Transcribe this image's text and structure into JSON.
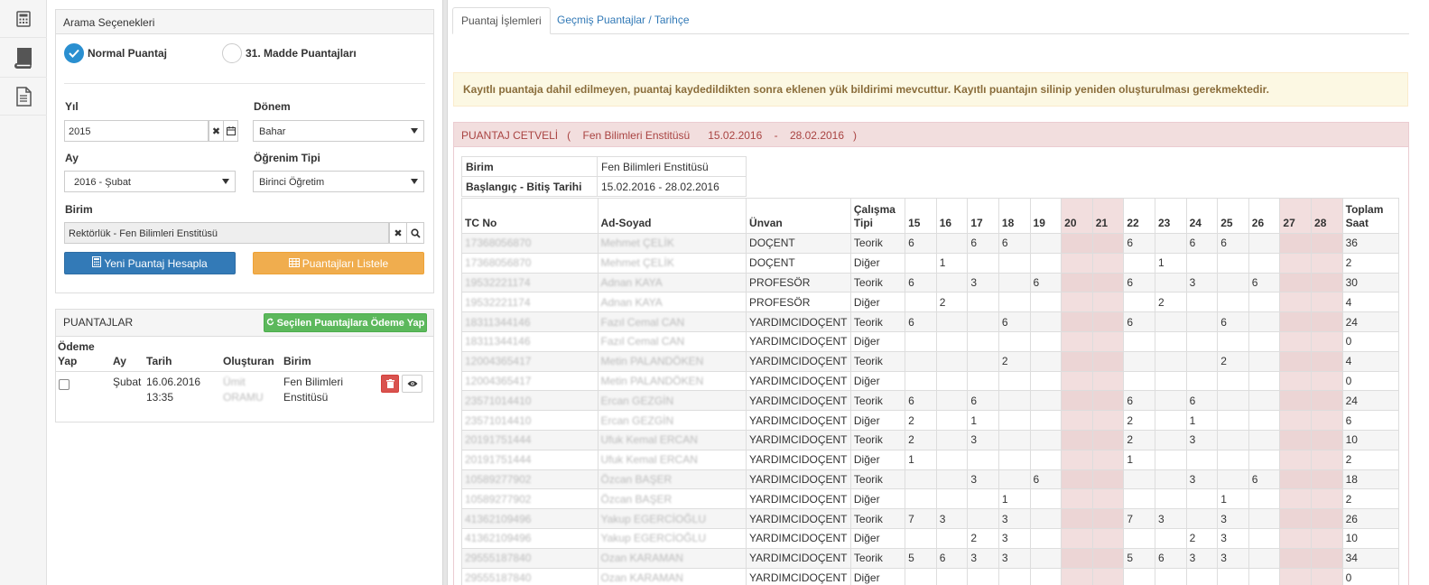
{
  "sidebar_icons": [
    "calculator-icon",
    "book-icon",
    "document-icon"
  ],
  "search": {
    "title": "Arama Seçenekleri",
    "radio_normal": "Normal Puantaj",
    "radio_madde": "31. Madde Puantajları",
    "yil_label": "Yıl",
    "yil_value": "2015",
    "donem_label": "Dönem",
    "donem_value": "Bahar",
    "ay_label": "Ay",
    "ay_value": "2016 - Şubat",
    "ogrenim_label": "Öğrenim Tipi",
    "ogrenim_value": "Birinci Öğretim",
    "birim_label": "Birim",
    "birim_value": "Rektörlük - Fen Bilimleri Enstitüsü",
    "btn_hesapla": "Yeni Puantaj Hesapla",
    "btn_listele": "Puantajları Listele"
  },
  "puantajlar": {
    "title": "PUANTAJLAR",
    "btn_odeme": "Seçilen Puantajlara Ödeme Yap",
    "col_odeme": "Ödeme Yap",
    "col_ay": "Ay",
    "col_tarih": "Tarih",
    "col_olusturan": "Oluşturan",
    "col_birim": "Birim",
    "row": {
      "ay": "Şubat",
      "tarih": "16.06.2016 13:35",
      "olusturan": "Ümit ORAMU",
      "birim": "Fen Bilimleri Enstitüsü"
    }
  },
  "tabs": [
    "Puantaj İşlemleri",
    "Geçmiş Puantajlar / Tarihçe"
  ],
  "alert": "Kayıtlı puantaja dahil edilmeyen, puantaj kaydedildikten sonra eklenen yük bildirimi mevcuttur. Kayıtlı puantajın silinip yeniden oluşturulması gerekmektedir.",
  "cetvel": {
    "title": "PUANTAJ CETVELİ",
    "birim": "Fen Bilimleri Enstitüsü",
    "start": "15.02.2016",
    "end": "28.02.2016",
    "info": [
      {
        "key": "Birim",
        "value": "Fen Bilimleri Enstitüsü"
      },
      {
        "key": "Başlangıç - Bitiş Tarihi",
        "value": "15.02.2016 - 28.02.2016"
      }
    ],
    "headers": {
      "tc": "TC No",
      "ad": "Ad-Soyad",
      "unvan": "Ünvan",
      "tip": "Çalışma Tipi",
      "days": [
        "15",
        "16",
        "17",
        "18",
        "19",
        "20",
        "21",
        "22",
        "23",
        "24",
        "25",
        "26",
        "27",
        "28"
      ],
      "toplam": "Toplam Saat"
    },
    "rows": [
      {
        "tc": "17368056870",
        "ad": "Mehmet ÇELİK",
        "unvan": "DOÇENT",
        "tip": "Teorik",
        "d": [
          "6",
          "",
          "6",
          "6",
          "",
          "",
          "",
          "6",
          "",
          "6",
          "6",
          "",
          "",
          ""
        ],
        "t": "36"
      },
      {
        "tc": "17368056870",
        "ad": "Mehmet ÇELİK",
        "unvan": "DOÇENT",
        "tip": "Diğer",
        "d": [
          "",
          "1",
          "",
          "",
          "",
          "",
          "",
          "",
          "1",
          "",
          "",
          "",
          "",
          ""
        ],
        "t": "2"
      },
      {
        "tc": "19532221174",
        "ad": "Adnan KAYA",
        "unvan": "PROFESÖR",
        "tip": "Teorik",
        "d": [
          "6",
          "",
          "3",
          "",
          "6",
          "",
          "",
          "6",
          "",
          "3",
          "",
          "6",
          "",
          ""
        ],
        "t": "30"
      },
      {
        "tc": "19532221174",
        "ad": "Adnan KAYA",
        "unvan": "PROFESÖR",
        "tip": "Diğer",
        "d": [
          "",
          "2",
          "",
          "",
          "",
          "",
          "",
          "",
          "2",
          "",
          "",
          "",
          "",
          ""
        ],
        "t": "4"
      },
      {
        "tc": "18311344146",
        "ad": "Fazıl Cemal CAN",
        "unvan": "YARDIMCIDOÇENT",
        "tip": "Teorik",
        "d": [
          "6",
          "",
          "",
          "6",
          "",
          "",
          "",
          "6",
          "",
          "",
          "6",
          "",
          "",
          ""
        ],
        "t": "24"
      },
      {
        "tc": "18311344146",
        "ad": "Fazıl Cemal CAN",
        "unvan": "YARDIMCIDOÇENT",
        "tip": "Diğer",
        "d": [
          "",
          "",
          "",
          "",
          "",
          "",
          "",
          "",
          "",
          "",
          "",
          "",
          "",
          ""
        ],
        "t": "0"
      },
      {
        "tc": "12004365417",
        "ad": "Metin PALANDÖKEN",
        "unvan": "YARDIMCIDOÇENT",
        "tip": "Teorik",
        "d": [
          "",
          "",
          "",
          "2",
          "",
          "",
          "",
          "",
          "",
          "",
          "2",
          "",
          "",
          ""
        ],
        "t": "4"
      },
      {
        "tc": "12004365417",
        "ad": "Metin PALANDÖKEN",
        "unvan": "YARDIMCIDOÇENT",
        "tip": "Diğer",
        "d": [
          "",
          "",
          "",
          "",
          "",
          "",
          "",
          "",
          "",
          "",
          "",
          "",
          "",
          ""
        ],
        "t": "0"
      },
      {
        "tc": "23571014410",
        "ad": "Ercan GEZGİN",
        "unvan": "YARDIMCIDOÇENT",
        "tip": "Teorik",
        "d": [
          "6",
          "",
          "6",
          "",
          "",
          "",
          "",
          "6",
          "",
          "6",
          "",
          "",
          "",
          ""
        ],
        "t": "24"
      },
      {
        "tc": "23571014410",
        "ad": "Ercan GEZGİN",
        "unvan": "YARDIMCIDOÇENT",
        "tip": "Diğer",
        "d": [
          "2",
          "",
          "1",
          "",
          "",
          "",
          "",
          "2",
          "",
          "1",
          "",
          "",
          "",
          ""
        ],
        "t": "6"
      },
      {
        "tc": "20191751444",
        "ad": "Ufuk Kemal ERCAN",
        "unvan": "YARDIMCIDOÇENT",
        "tip": "Teorik",
        "d": [
          "2",
          "",
          "3",
          "",
          "",
          "",
          "",
          "2",
          "",
          "3",
          "",
          "",
          "",
          ""
        ],
        "t": "10"
      },
      {
        "tc": "20191751444",
        "ad": "Ufuk Kemal ERCAN",
        "unvan": "YARDIMCIDOÇENT",
        "tip": "Diğer",
        "d": [
          "1",
          "",
          "",
          "",
          "",
          "",
          "",
          "1",
          "",
          "",
          "",
          "",
          "",
          ""
        ],
        "t": "2"
      },
      {
        "tc": "10589277902",
        "ad": "Özcan BAŞER",
        "unvan": "YARDIMCIDOÇENT",
        "tip": "Teorik",
        "d": [
          "",
          "",
          "3",
          "",
          "6",
          "",
          "",
          "",
          "",
          "3",
          "",
          "6",
          "",
          ""
        ],
        "t": "18"
      },
      {
        "tc": "10589277902",
        "ad": "Özcan BAŞER",
        "unvan": "YARDIMCIDOÇENT",
        "tip": "Diğer",
        "d": [
          "",
          "",
          "",
          "1",
          "",
          "",
          "",
          "",
          "",
          "",
          "1",
          "",
          "",
          ""
        ],
        "t": "2"
      },
      {
        "tc": "41362109496",
        "ad": "Yakup EGERCİOĞLU",
        "unvan": "YARDIMCIDOÇENT",
        "tip": "Teorik",
        "d": [
          "7",
          "3",
          "",
          "3",
          "",
          "",
          "",
          "7",
          "3",
          "",
          "3",
          "",
          "",
          ""
        ],
        "t": "26"
      },
      {
        "tc": "41362109496",
        "ad": "Yakup EGERCİOĞLU",
        "unvan": "YARDIMCIDOÇENT",
        "tip": "Diğer",
        "d": [
          "",
          "",
          "2",
          "3",
          "",
          "",
          "",
          "",
          "",
          "2",
          "3",
          "",
          "",
          ""
        ],
        "t": "10"
      },
      {
        "tc": "29555187840",
        "ad": "Ozan KARAMAN",
        "unvan": "YARDIMCIDOÇENT",
        "tip": "Teorik",
        "d": [
          "5",
          "6",
          "3",
          "3",
          "",
          "",
          "",
          "5",
          "6",
          "3",
          "3",
          "",
          "",
          ""
        ],
        "t": "34"
      },
      {
        "tc": "29555187840",
        "ad": "Ozan KARAMAN",
        "unvan": "YARDIMCIDOÇENT",
        "tip": "Diğer",
        "d": [
          "",
          "",
          "",
          "",
          "",
          "",
          "",
          "",
          "",
          "",
          "",
          "",
          "",
          ""
        ],
        "t": "0"
      }
    ]
  }
}
